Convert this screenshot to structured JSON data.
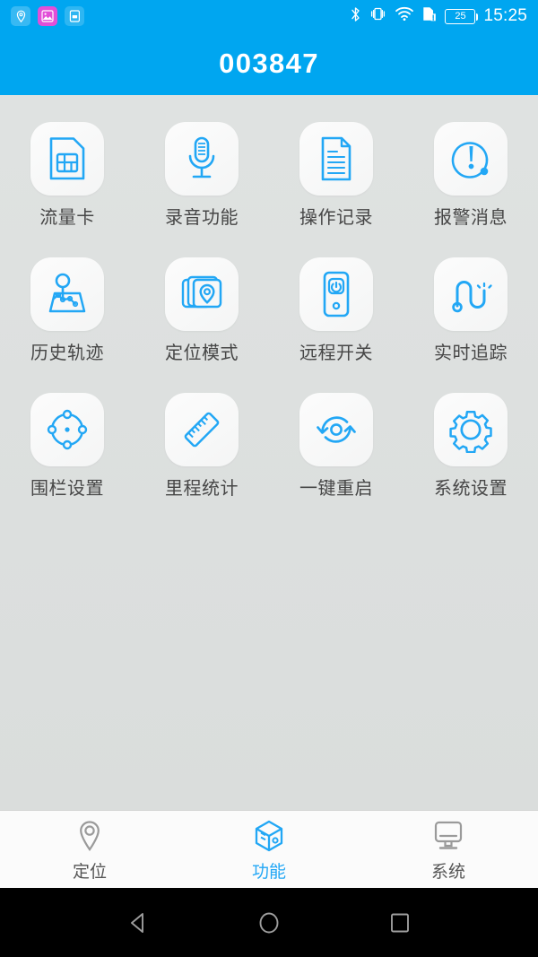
{
  "status_bar": {
    "notifications": [
      {
        "icon": "location-pin-icon",
        "style": "pin"
      },
      {
        "icon": "image-screenshot-icon",
        "style": "pic"
      },
      {
        "icon": "sim-card-notification-icon",
        "style": "card"
      }
    ],
    "indicators": [
      {
        "icon": "bluetooth-icon"
      },
      {
        "icon": "vibrate-icon"
      },
      {
        "icon": "wifi-icon"
      },
      {
        "icon": "sim-alert-icon"
      }
    ],
    "battery_level": "25",
    "time": "15:25"
  },
  "header": {
    "title": "003847"
  },
  "colors": {
    "accent": "#00a6f0",
    "icon_blue": "#22a7f5",
    "label_text": "#464646",
    "tab_inactive": "#9a9a9a",
    "page_bg": "#dcdfde",
    "tile_bg": "#f7f8f8"
  },
  "grid": {
    "items": [
      {
        "label": "流量卡",
        "icon": "sim-card-icon"
      },
      {
        "label": "录音功能",
        "icon": "microphone-icon"
      },
      {
        "label": "操作记录",
        "icon": "document-lines-icon"
      },
      {
        "label": "报警消息",
        "icon": "alert-exclamation-icon"
      },
      {
        "label": "历史轨迹",
        "icon": "route-map-icon"
      },
      {
        "label": "定位模式",
        "icon": "map-pin-layers-icon"
      },
      {
        "label": "远程开关",
        "icon": "remote-power-device-icon"
      },
      {
        "label": "实时追踪",
        "icon": "live-track-path-icon"
      },
      {
        "label": "围栏设置",
        "icon": "geofence-circle-icon"
      },
      {
        "label": "里程统计",
        "icon": "ruler-icon"
      },
      {
        "label": "一键重启",
        "icon": "restart-arrows-icon"
      },
      {
        "label": "系统设置",
        "icon": "gear-icon"
      }
    ]
  },
  "tabbar": {
    "items": [
      {
        "label": "定位",
        "icon": "map-pin-icon",
        "active": false
      },
      {
        "label": "功能",
        "icon": "cube-icon",
        "active": true
      },
      {
        "label": "系统",
        "icon": "monitor-icon",
        "active": false
      }
    ]
  },
  "android_nav": {
    "buttons": [
      {
        "name": "back-button"
      },
      {
        "name": "home-button"
      },
      {
        "name": "recents-button"
      }
    ]
  }
}
